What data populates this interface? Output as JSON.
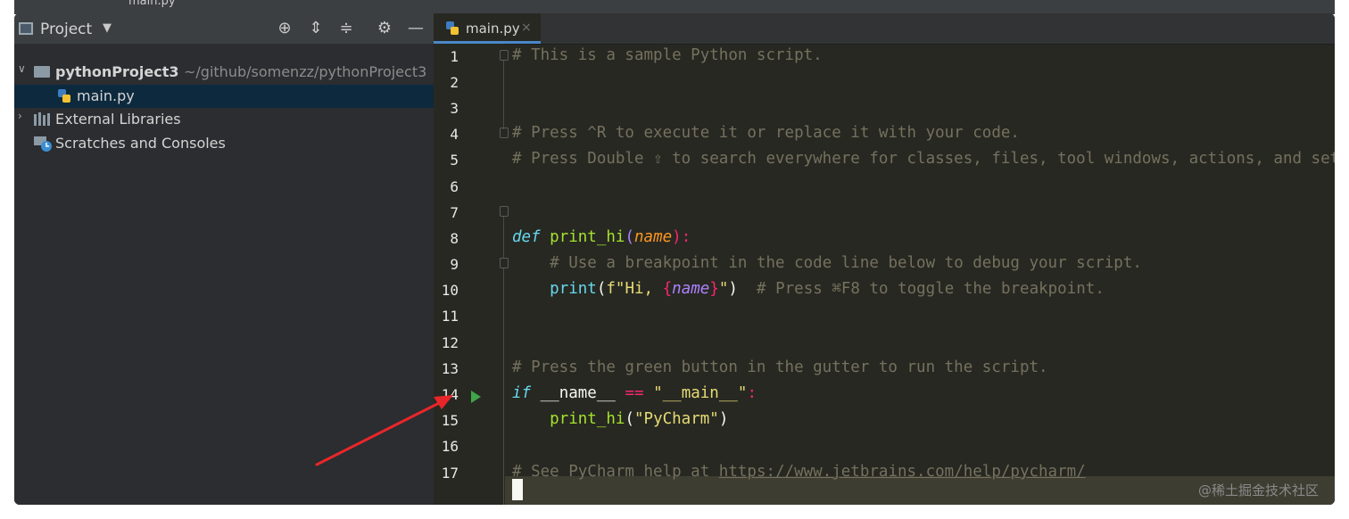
{
  "topbar": {
    "crumb": "main.py"
  },
  "project_panel": {
    "title": "Project",
    "tree": [
      {
        "label": "pythonProject3",
        "path": "~/github/somenzz/pythonProject3"
      },
      {
        "label": "main.py"
      },
      {
        "label": "External Libraries"
      },
      {
        "label": "Scratches and Consoles"
      }
    ]
  },
  "editor": {
    "tab_label": "main.py",
    "tab_close": "×",
    "line_numbers": [
      "1",
      "2",
      "3",
      "4",
      "5",
      "6",
      "7",
      "8",
      "9",
      "10",
      "11",
      "12",
      "13",
      "14",
      "15",
      "16",
      "17"
    ],
    "lines": {
      "l1": "# This is a sample Python script.",
      "l3": "# Press ^R to execute it or replace it with your code.",
      "l4": "# Press Double ⇧ to search everywhere for classes, files, tool windows, actions, and settings.",
      "l7_def": "def",
      "l7_name": "print_hi",
      "l7_open": "(",
      "l7_param": "name",
      "l7_close": "):",
      "l8": "# Use a breakpoint in the code line below to debug your script.",
      "l9_print": "print",
      "l9_open": "(",
      "l9_fstr1": "f\"Hi, ",
      "l9_lbrace": "{",
      "l9_var": "name",
      "l9_rbrace": "}",
      "l9_fstr2": "\"",
      "l9_close": ")",
      "l9_comment": "# Press ⌘F8 to toggle the breakpoint.",
      "l12": "# Press the green button in the gutter to run the script.",
      "l13_if": "if",
      "l13_name": "__name__",
      "l13_eq": "==",
      "l13_str": "\"__main__\"",
      "l13_colon": ":",
      "l14_call": "print_hi",
      "l14_open": "(",
      "l14_str": "\"PyCharm\"",
      "l14_close": ")",
      "l16_text": "# See PyCharm help at ",
      "l16_link": "https://www.jetbrains.com/help/pycharm/"
    }
  },
  "watermark": "@稀土掘金技术社区",
  "colors": {
    "run_button": "#3fa54a",
    "annotation_arrow": "#e8262a",
    "selection": "#0d293e",
    "tab_underline": "#4a88c7"
  }
}
